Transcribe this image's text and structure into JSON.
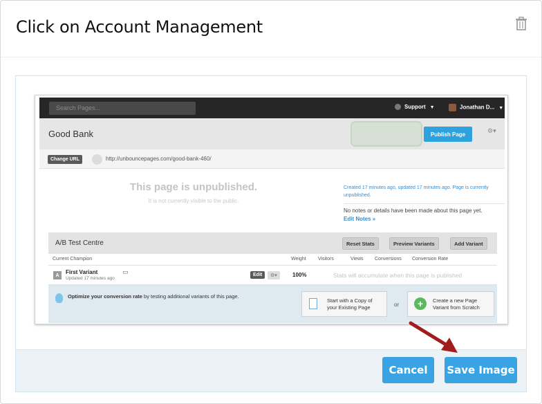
{
  "modal": {
    "title": "Click on Account Management",
    "cancel_label": "Cancel",
    "save_label": "Save Image"
  },
  "shot": {
    "search_placeholder": "Search Pages...",
    "support_label": "Support",
    "user_label": "Jonathan D...",
    "page_title": "Good Bank",
    "publish_label": "Publish Page",
    "change_url_label": "Change URL",
    "url": "http://unbouncepages.com/good-bank-460/",
    "unpublished_title": "This page is unpublished.",
    "unpublished_sub": "It is not currently visible to the public.",
    "created_info": "Created 17 minutes ago, updated 17 minutes ago. Page is currently unpublished.",
    "notes_info": "No notes or details have been made about this page yet.",
    "edit_notes": "Edit Notes »",
    "ab_title": "A/B Test Centre",
    "reset_stats": "Reset Stats",
    "preview_variants": "Preview Variants",
    "add_variant": "Add Variant",
    "columns": [
      "Current Champion",
      "Weight",
      "Visitors",
      "Views",
      "Conversions",
      "Conversion Rate"
    ],
    "variant_badge": "A",
    "variant_name": "First Variant",
    "variant_updated": "Updated 17 minutes ago",
    "edit_label": "Edit",
    "weight": "100%",
    "accumulate": "Stats will accumulate when this page is published",
    "optimize_bold": "Optimize your conversion rate",
    "optimize_rest": " by testing additional variants of this page.",
    "copy_line1": "Start with a Copy of",
    "copy_line2": "your Existing Page",
    "or": "or",
    "scratch_line1": "Create a new Page",
    "scratch_line2": "Variant from Scratch"
  },
  "colors": {
    "accent": "#3aa3e3",
    "arrow": "#a31c1c",
    "footer_bg": "#edf2f6"
  },
  "icons": [
    "trash-icon",
    "lock-icon",
    "monitor-icon",
    "bulb-icon",
    "copy-icon",
    "plus-icon",
    "arrow-annotation"
  ]
}
